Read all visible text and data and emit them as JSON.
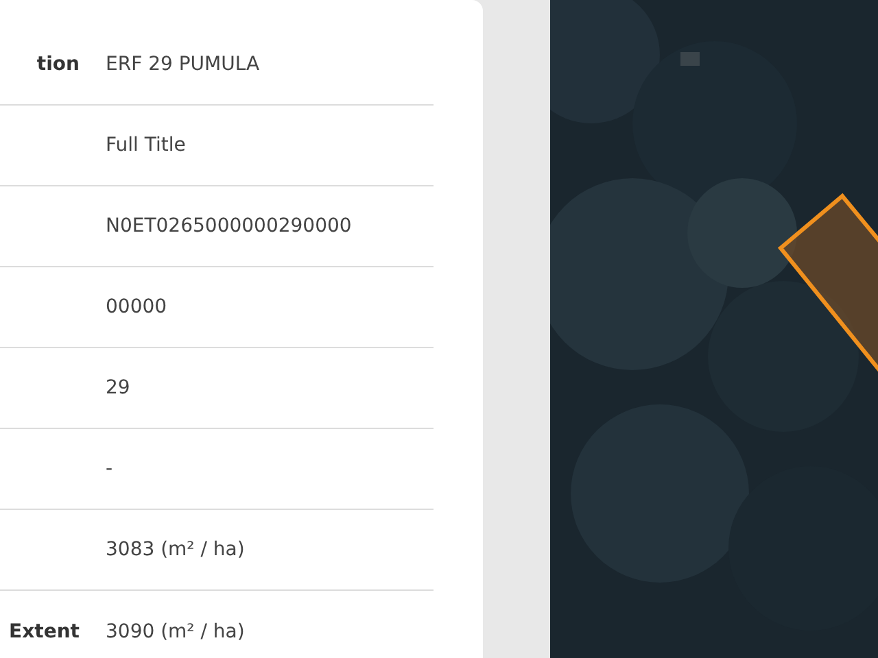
{
  "details": {
    "rows": [
      {
        "label": "tion",
        "value": "ERF 29 PUMULA"
      },
      {
        "value": "Full Title"
      },
      {
        "value": "N0ET0265000000290000"
      },
      {
        "value": "00000"
      },
      {
        "value": "29"
      },
      {
        "value": "-"
      },
      {
        "value": "3083 (m² / ha)"
      },
      {
        "label": "Extent",
        "value": "3090 (m² / ha)"
      }
    ]
  }
}
